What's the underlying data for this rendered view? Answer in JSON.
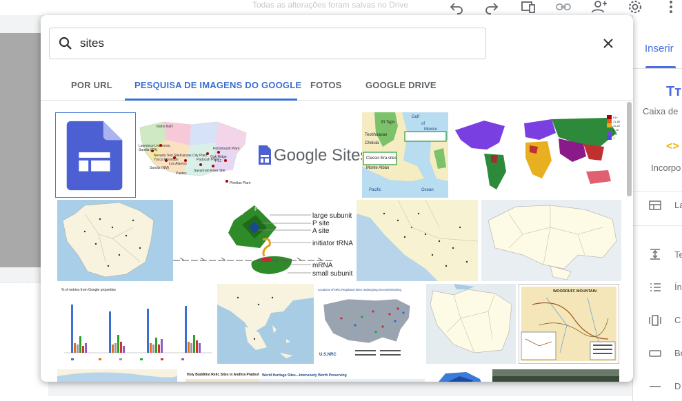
{
  "topbar": {
    "saved_text": "Todas as alterações foram salvas no Drive",
    "icons": [
      "undo-icon",
      "redo-icon",
      "preview-icon",
      "link-icon",
      "add-person-icon",
      "gear-icon",
      "more-vert-icon"
    ]
  },
  "right_panel": {
    "tab_label": "Inserir",
    "items": [
      {
        "icon": "text-box-icon",
        "glyph": "Tт",
        "label": "Caixa de"
      },
      {
        "icon": "embed-icon",
        "glyph": "<>",
        "label": "Incorpo"
      },
      {
        "icon": "layout-icon",
        "label": "La"
      },
      {
        "icon": "collapsible-text-icon",
        "label": "Te"
      },
      {
        "icon": "toc-icon",
        "label": "Ín"
      },
      {
        "icon": "carousel-icon",
        "label": "C"
      },
      {
        "icon": "button-icon",
        "label": "Bo"
      },
      {
        "icon": "divider-icon",
        "label": "D"
      }
    ]
  },
  "dialog": {
    "search": {
      "value": "sites",
      "placeholder": ""
    },
    "tabs": [
      {
        "label": "POR URL",
        "active": false
      },
      {
        "label": "PESQUISA DE IMAGENS DO GOOGLE",
        "active": true
      },
      {
        "label": "FOTOS",
        "active": false
      },
      {
        "label": "GOOGLE DRIVE",
        "active": false
      }
    ],
    "images": {
      "row1": [
        {
          "name": "google-sites-logo-image",
          "selected": true
        },
        {
          "name": "us-map-sites-image",
          "labels": [
            "Lawrence Livermore, Sandia (CA)",
            "Nevada Test Site",
            "Yucca Mountain",
            "Los Alamos",
            "Sandia (NM)",
            "Pantex",
            "Savannah River Site",
            "Oak Ridge",
            "Y-12",
            "Kansas City Plant",
            "Paducah Plant",
            "Portsmouth Plant",
            "Pinellas Plant"
          ]
        },
        {
          "name": "google-sites-wordmark-image",
          "text": "Google Sites"
        },
        {
          "name": "mexico-sites-map-image",
          "labels": [
            "Gulf of Mexico",
            "El Tajín",
            "Teotihuacan",
            "Cholula",
            "Monte Albán",
            "Classic Era sites",
            "Pacific Ocean"
          ]
        },
        {
          "name": "world-sites-map-image"
        }
      ],
      "row2": [
        {
          "name": "france-map-image"
        },
        {
          "name": "ribosome-diagram-image",
          "labels": [
            "large subunit",
            "P site",
            "A site",
            "initiator tRNA",
            "mRNA",
            "small subunit"
          ]
        },
        {
          "name": "adriatic-sites-map-image"
        },
        {
          "name": "ukraine-map-image"
        }
      ],
      "row3": [
        {
          "name": "bar-chart-image",
          "title": "% of entries from Google properties"
        },
        {
          "name": "greece-map-image"
        },
        {
          "name": "usa-nrc-sites-map-image",
          "title": "Locations of NRC-Regulated Sites Undergoing Decommissioning"
        },
        {
          "name": "iran-map-image"
        },
        {
          "name": "woodruff-mountain-map-image",
          "title": "WOODRUFF MOUNTAIN"
        }
      ],
      "row4": [
        {
          "name": "blue-map-image"
        },
        {
          "name": "buddhist-sites-image",
          "title": "Holy Buddhist Relic Sites in Andhra Pradesh"
        },
        {
          "name": "world-heritage-sites-image",
          "title": "World Heritage Sites—Intensively Worth Preserving"
        },
        {
          "name": "blue-density-map-image"
        },
        {
          "name": "dark-photo-image"
        }
      ]
    }
  },
  "colors": {
    "accent": "#3b6fd1",
    "sites_purple": "#4c5fd3"
  }
}
